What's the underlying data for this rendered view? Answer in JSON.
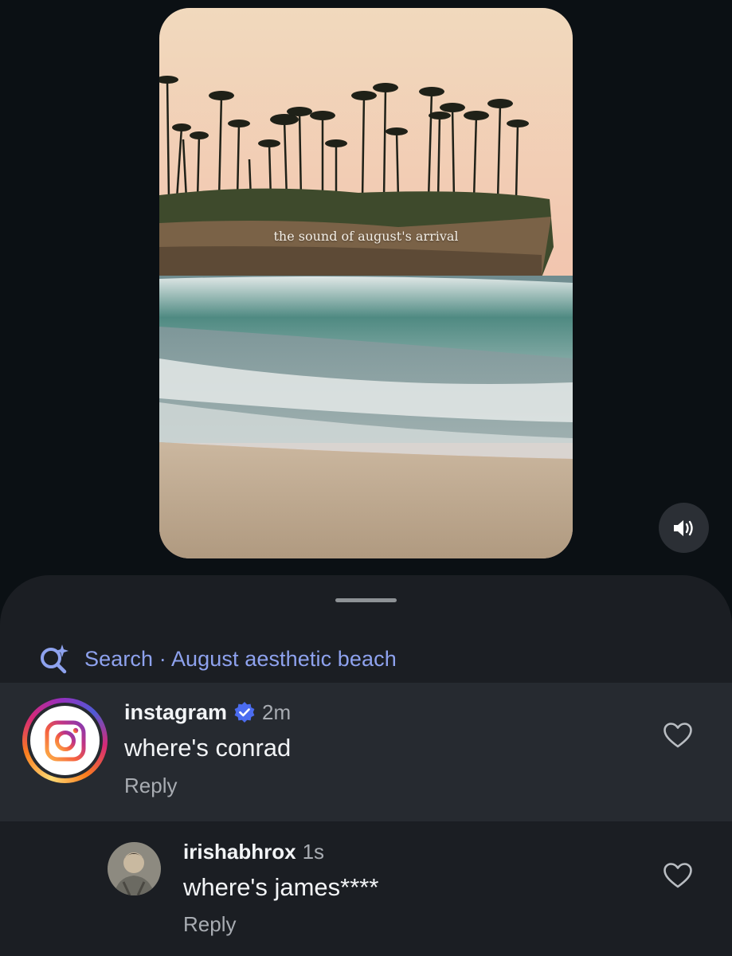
{
  "video": {
    "caption": "the sound of august's arrival"
  },
  "search": {
    "label": "Search · August aesthetic beach",
    "accent_color": "#8ea2ee",
    "icon": "search-sparkle-icon"
  },
  "comments": [
    {
      "username": "instagram",
      "verified": true,
      "time": "2m",
      "text": "where's conrad",
      "reply_label": "Reply",
      "highlighted": true
    },
    {
      "username": "irishabhrox",
      "verified": false,
      "time": "1s",
      "text": "where's james****",
      "reply_label": "Reply",
      "highlighted": false
    }
  ],
  "colors": {
    "background": "#0b1014",
    "sheet": "#1b1e23",
    "highlight_row": "#262a30",
    "verified_badge": "#4b6cf0"
  }
}
